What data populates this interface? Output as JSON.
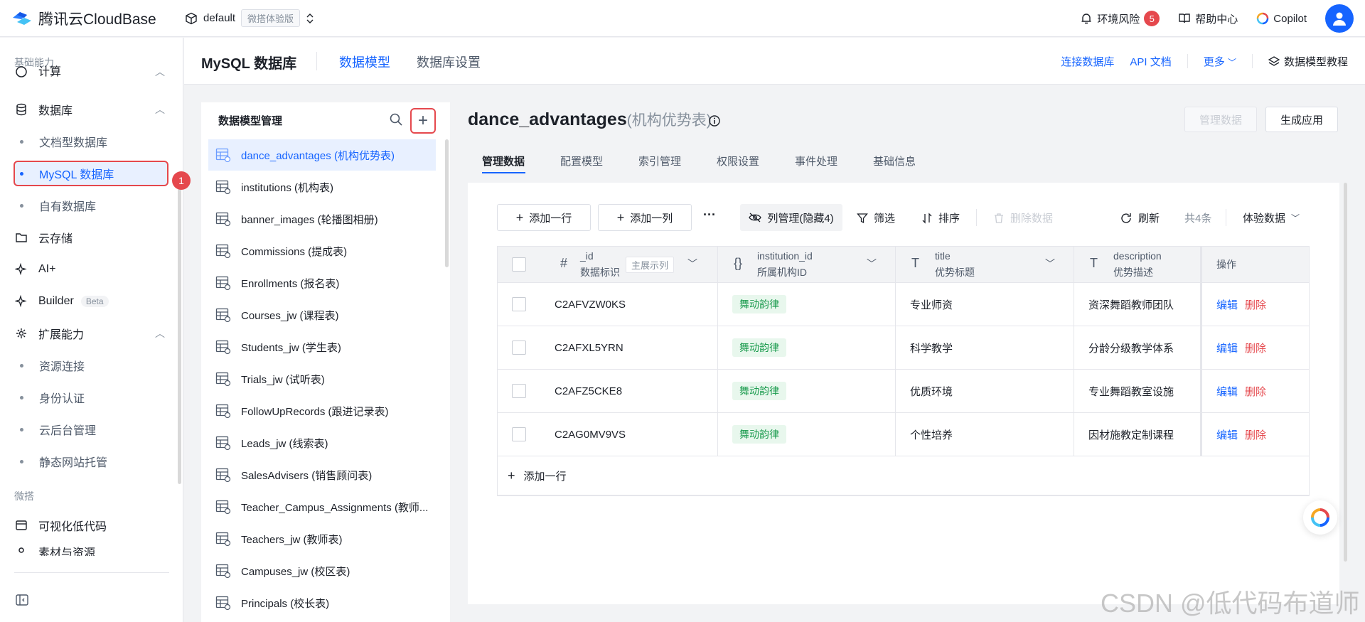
{
  "topbar": {
    "brand": "腾讯云CloudBase",
    "env_name": "default",
    "env_tag": "微搭体验版",
    "env_risk_label": "环境风险",
    "env_risk_count": "5",
    "help_label": "帮助中心",
    "copilot_label": "Copilot"
  },
  "sidebar": {
    "group_basic": "基础能力",
    "compute": "计算",
    "database": "数据库",
    "doc_db": "文档型数据库",
    "mysql_db": "MySQL 数据库",
    "own_db": "自有数据库",
    "storage": "云存储",
    "ai": "AI+",
    "builder": "Builder",
    "builder_badge": "Beta",
    "ext": "扩展能力",
    "res_conn": "资源连接",
    "auth": "身份认证",
    "backend": "云后台管理",
    "static": "静态网站托管",
    "group_weda": "微搭",
    "lowcode": "可视化低代码",
    "assets": "素材与资源",
    "step_number": "1"
  },
  "subheader": {
    "title": "MySQL 数据库",
    "tabs": [
      "数据模型",
      "数据库设置"
    ],
    "connect_db": "连接数据库",
    "api_doc": "API 文档",
    "more": "更多",
    "tutorial": "数据模型教程"
  },
  "model_panel": {
    "title": "数据模型管理",
    "add_symbol": "+",
    "items": [
      "dance_advantages (机构优势表)",
      "institutions (机构表)",
      "banner_images (轮播图相册)",
      "Commissions (提成表)",
      "Enrollments (报名表)",
      "Courses_jw (课程表)",
      "Students_jw (学生表)",
      "Trials_jw (试听表)",
      "FollowUpRecords (跟进记录表)",
      "Leads_jw (线索表)",
      "SalesAdvisers (销售顾问表)",
      "Teacher_Campus_Assignments (教师...",
      "Teachers_jw (教师表)",
      "Campuses_jw (校区表)",
      "Principals (校长表)"
    ]
  },
  "main": {
    "model_name": "dance_advantages",
    "model_cn": "(机构优势表)",
    "btn_manage": "管理数据",
    "btn_generate": "生成应用",
    "tabs": [
      "管理数据",
      "配置模型",
      "索引管理",
      "权限设置",
      "事件处理",
      "基础信息"
    ]
  },
  "toolbar": {
    "add_row": "添加一行",
    "add_col": "添加一列",
    "more": "···",
    "col_manage": "列管理(隐藏4)",
    "filter": "筛选",
    "sort": "排序",
    "delete": "删除数据",
    "refresh": "刷新",
    "total": "共4条",
    "data_mode": "体验数据"
  },
  "table": {
    "columns": [
      {
        "name": "_id",
        "desc": "数据标识",
        "type": "#",
        "extra": "主展示列"
      },
      {
        "name": "institution_id",
        "desc": "所属机构ID",
        "type": "{}"
      },
      {
        "name": "title",
        "desc": "优势标题",
        "type": "T"
      },
      {
        "name": "description",
        "desc": "优势描述",
        "type": "T"
      }
    ],
    "op_header": "操作",
    "rows": [
      {
        "id": "C2AFVZW0KS",
        "institution": "舞动韵律",
        "title": "专业师资",
        "desc": "资深舞蹈教师团队"
      },
      {
        "id": "C2AFXL5YRN",
        "institution": "舞动韵律",
        "title": "科学教学",
        "desc": "分龄分级教学体系"
      },
      {
        "id": "C2AFZ5CKE8",
        "institution": "舞动韵律",
        "title": "优质环境",
        "desc": "专业舞蹈教室设施"
      },
      {
        "id": "C2AG0MV9VS",
        "institution": "舞动韵律",
        "title": "个性培养",
        "desc": "因材施教定制课程"
      }
    ],
    "edit": "编辑",
    "delete": "删除",
    "add_row": "添加一行"
  },
  "watermark": "CSDN @低代码布道师"
}
